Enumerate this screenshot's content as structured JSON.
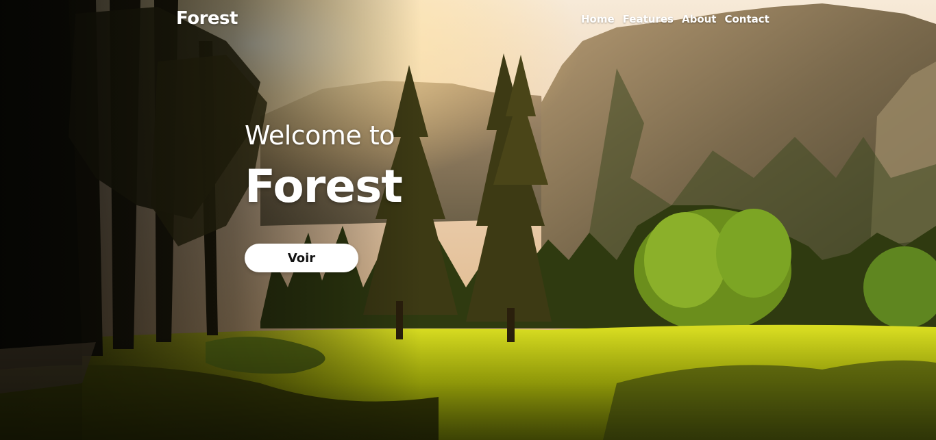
{
  "navbar": {
    "logo": "Forest",
    "links": [
      {
        "label": "Home"
      },
      {
        "label": "Features"
      },
      {
        "label": "About"
      },
      {
        "label": "Contact"
      }
    ]
  },
  "hero": {
    "welcome": "Welcome to",
    "title": "Forest",
    "button_label": "Voir"
  },
  "colors": {
    "text": "#ffffff",
    "button_bg": "#ffffff",
    "button_text": "#111111",
    "meadow": "#c9d20a"
  }
}
